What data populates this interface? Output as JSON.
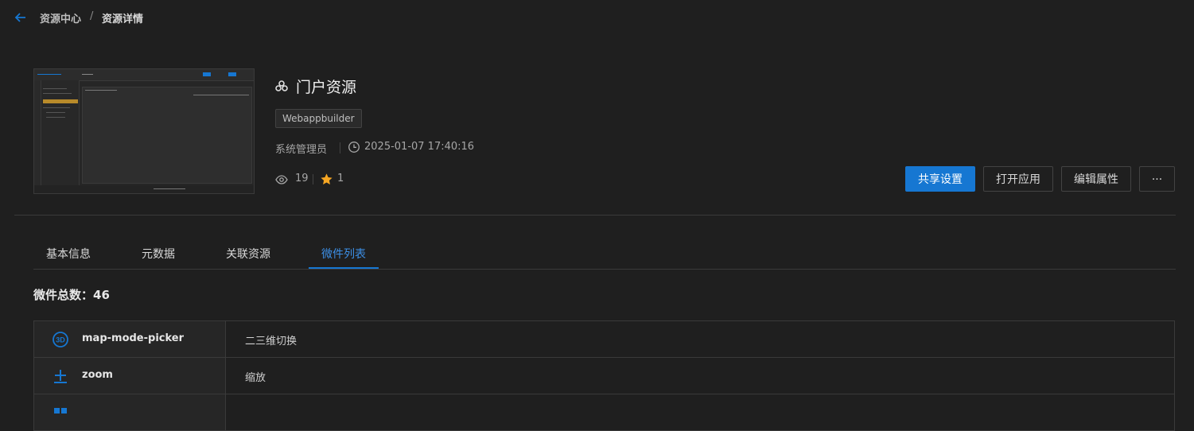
{
  "breadcrumb": {
    "root": "资源中心",
    "separator": "/",
    "current": "资源详情"
  },
  "resource": {
    "title": "门户资源",
    "tag": "Webappbuilder",
    "owner": "系统管理员",
    "timestamp": "2025-01-07 17:40:16",
    "views": "19",
    "stars": "1"
  },
  "actions": {
    "share": "共享设置",
    "open": "打开应用",
    "edit": "编辑属性",
    "more": "···"
  },
  "tabs": [
    {
      "label": "基本信息",
      "active": false
    },
    {
      "label": "元数据",
      "active": false
    },
    {
      "label": "关联资源",
      "active": false
    },
    {
      "label": "微件列表",
      "active": true
    }
  ],
  "widget_total": "微件总数：46",
  "widgets": [
    {
      "icon": "3d-icon",
      "name": "map-mode-picker",
      "desc": "二三维切换"
    },
    {
      "icon": "zoom-icon",
      "name": "zoom",
      "desc": "缩放"
    },
    {
      "icon": "grid-icon",
      "name": "",
      "desc": ""
    }
  ],
  "colors": {
    "accent": "#1677d2",
    "star": "#f5a623",
    "background": "#1f1f1f"
  }
}
